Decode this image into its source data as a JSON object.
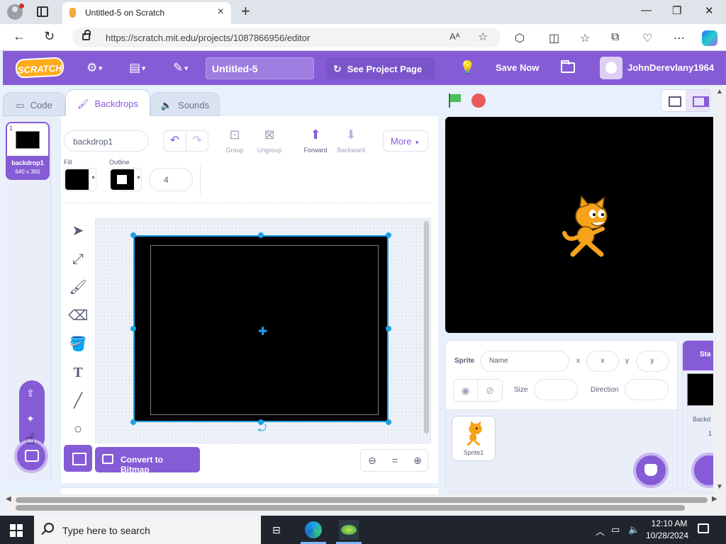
{
  "browser": {
    "tab_title": "Untitled-5 on Scratch",
    "url": "https://scratch.mit.edu/projects/1087866956/editor",
    "read_aloud": "Aᴬ"
  },
  "menu": {
    "logo": "SCRATCH",
    "project_title": "Untitled-5",
    "see_project": "See Project Page",
    "save_now": "Save Now",
    "username": "JohnDerevlany1964"
  },
  "editor_tabs": [
    {
      "label": "Code"
    },
    {
      "label": "Backdrops"
    },
    {
      "label": "Sounds"
    }
  ],
  "backdrops": [
    {
      "number": "1",
      "name": "backdrop1",
      "size": "640 x 360"
    }
  ],
  "paint": {
    "costume_name": "backdrop1",
    "group": "Group",
    "ungroup": "Ungroup",
    "forward": "Forward",
    "backward": "Backward",
    "more": "More",
    "fill_label": "Fill",
    "outline_label": "Outline",
    "outline_width": "4",
    "convert": "Convert to Bitmap",
    "zoom_reset": "="
  },
  "sprite_info": {
    "sprite_label": "Sprite",
    "name_placeholder": "Name",
    "x_label": "x",
    "x_placeholder": "x",
    "y_label": "y",
    "y_placeholder": "y",
    "size_label": "Size",
    "direction_label": "Direction"
  },
  "sprites": [
    {
      "name": "Sprite1"
    }
  ],
  "stage_pane": {
    "header": "Sta",
    "backdrops_label": "Backd",
    "count": "1"
  },
  "taskbar": {
    "search_placeholder": "Type here to search",
    "time": "12:10 AM",
    "date": "10/28/2024"
  },
  "colors": {
    "scratch_purple": "#855cd6",
    "selection_blue": "#1fa0e6",
    "flag_green": "#4cbf56",
    "stop_red": "#ec5959"
  }
}
